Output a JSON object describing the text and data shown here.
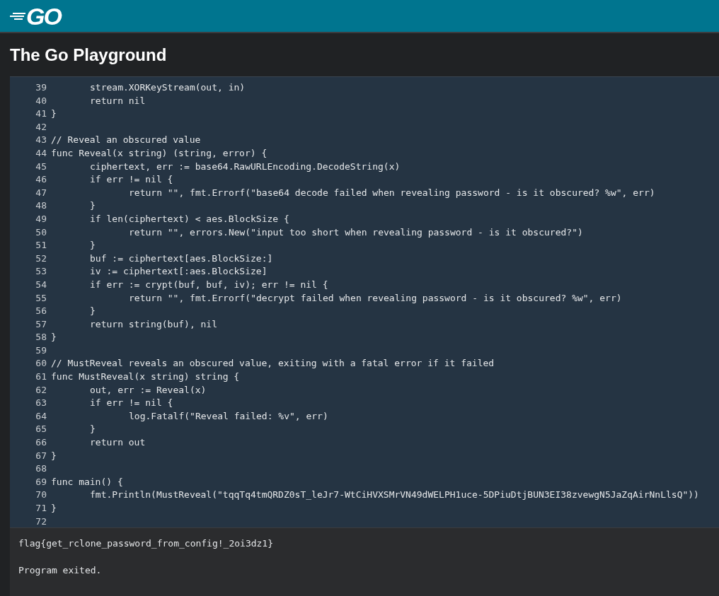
{
  "header": {
    "logo": "GO"
  },
  "title": "The Go Playground",
  "editor": {
    "lines": [
      {
        "number": "39",
        "code": "\tstream.XORKeyStream(out, in)"
      },
      {
        "number": "40",
        "code": "\treturn nil"
      },
      {
        "number": "41",
        "code": "}"
      },
      {
        "number": "42"
      },
      {
        "number": "43",
        "code": "// Reveal an obscured value"
      },
      {
        "number": "44",
        "code": "func Reveal(x string) (string, error) {"
      },
      {
        "number": "45",
        "code": "\tciphertext, err := base64.RawURLEncoding.DecodeString(x)"
      },
      {
        "number": "46",
        "code": "\tif err != nil {"
      },
      {
        "number": "47",
        "code": "\t\treturn \"\", fmt.Errorf(\"base64 decode failed when revealing password - is it obscured? %w\", err)"
      },
      {
        "number": "48",
        "code": "\t}"
      },
      {
        "number": "49",
        "code": "\tif len(ciphertext) < aes.BlockSize {"
      },
      {
        "number": "50",
        "code": "\t\treturn \"\", errors.New(\"input too short when revealing password - is it obscured?\")"
      },
      {
        "number": "51",
        "code": "\t}"
      },
      {
        "number": "52",
        "code": "\tbuf := ciphertext[aes.BlockSize:]"
      },
      {
        "number": "53",
        "code": "\tiv := ciphertext[:aes.BlockSize]"
      },
      {
        "number": "54",
        "code": "\tif err := crypt(buf, buf, iv); err != nil {"
      },
      {
        "number": "55",
        "code": "\t\treturn \"\", fmt.Errorf(\"decrypt failed when revealing password - is it obscured? %w\", err)"
      },
      {
        "number": "56",
        "code": "\t}"
      },
      {
        "number": "57",
        "code": "\treturn string(buf), nil"
      },
      {
        "number": "58",
        "code": "}"
      },
      {
        "number": "59"
      },
      {
        "number": "60",
        "code": "// MustReveal reveals an obscured value, exiting with a fatal error if it failed"
      },
      {
        "number": "61",
        "code": "func MustReveal(x string) string {"
      },
      {
        "number": "62",
        "code": "\tout, err := Reveal(x)"
      },
      {
        "number": "63",
        "code": "\tif err != nil {"
      },
      {
        "number": "64",
        "code": "\t\tlog.Fatalf(\"Reveal failed: %v\", err)"
      },
      {
        "number": "65",
        "code": "\t}"
      },
      {
        "number": "66",
        "code": "\treturn out"
      },
      {
        "number": "67",
        "code": "}"
      },
      {
        "number": "68"
      },
      {
        "number": "69",
        "code": "func main() {"
      },
      {
        "number": "70",
        "code": "\tfmt.Println(MustReveal(\"tqqTq4tmQRDZ0sT_leJr7-WtCiHVXSMrVN49dWELPH1uce-5DPiuDtjBUN3EI38zvewgN5JaZqAirNnLlsQ\"))"
      },
      {
        "number": "71",
        "code": "}"
      },
      {
        "number": "72"
      }
    ]
  },
  "output": {
    "lines": [
      "flag{get_rclone_password_from_config!_2oi3dz1}",
      "Program exited."
    ]
  }
}
